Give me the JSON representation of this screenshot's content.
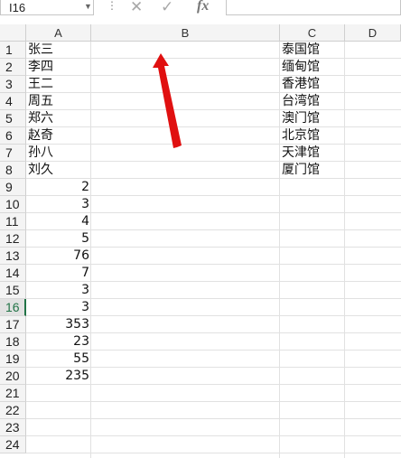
{
  "name_box": {
    "value": "I16"
  },
  "formula_bar": {
    "value": ""
  },
  "columns": [
    "A",
    "B",
    "C",
    "D"
  ],
  "active_row": "16",
  "rows": [
    {
      "n": "1",
      "a": "张三",
      "c": "泰国馆"
    },
    {
      "n": "2",
      "a": "李四",
      "c": "缅甸馆"
    },
    {
      "n": "3",
      "a": "王二",
      "c": "香港馆"
    },
    {
      "n": "4",
      "a": "周五",
      "c": "台湾馆"
    },
    {
      "n": "5",
      "a": "郑六",
      "c": "澳门馆"
    },
    {
      "n": "6",
      "a": "赵奇",
      "c": "北京馆"
    },
    {
      "n": "7",
      "a": "孙八",
      "c": "天津馆"
    },
    {
      "n": "8",
      "a": "刘久",
      "c": "厦门馆"
    },
    {
      "n": "9",
      "a": "2",
      "c": ""
    },
    {
      "n": "10",
      "a": "3",
      "c": ""
    },
    {
      "n": "11",
      "a": "4",
      "c": ""
    },
    {
      "n": "12",
      "a": "5",
      "c": ""
    },
    {
      "n": "13",
      "a": "76",
      "c": ""
    },
    {
      "n": "14",
      "a": "7",
      "c": ""
    },
    {
      "n": "15",
      "a": "3",
      "c": ""
    },
    {
      "n": "16",
      "a": "3",
      "c": ""
    },
    {
      "n": "17",
      "a": "353",
      "c": ""
    },
    {
      "n": "18",
      "a": "23",
      "c": ""
    },
    {
      "n": "19",
      "a": "55",
      "c": ""
    },
    {
      "n": "20",
      "a": "235",
      "c": ""
    },
    {
      "n": "21",
      "a": "",
      "c": ""
    },
    {
      "n": "22",
      "a": "",
      "c": ""
    },
    {
      "n": "23",
      "a": "",
      "c": ""
    },
    {
      "n": "24",
      "a": "",
      "c": ""
    }
  ],
  "annotation_color": "#e01010",
  "icons": {
    "cancel": "cancel-icon",
    "confirm": "check-icon",
    "function": "fx-icon"
  }
}
